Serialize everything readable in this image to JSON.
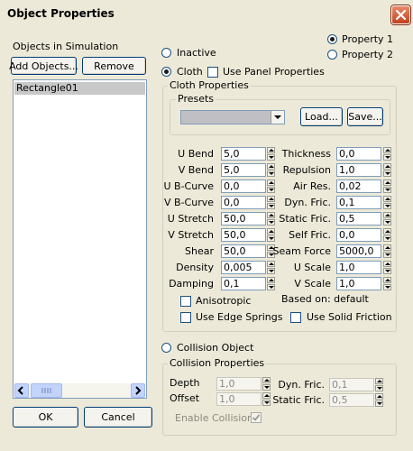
{
  "window": {
    "title": "Object Properties"
  },
  "objects_panel": {
    "heading": "Objects in Simulation",
    "add_button": "Add Objects...",
    "remove_button": "Remove",
    "items": [
      "Rectangle01"
    ]
  },
  "modes": {
    "inactive": "Inactive",
    "cloth": "Cloth",
    "use_panel_properties": "Use Panel Properties",
    "property1": "Property 1",
    "property2": "Property 2",
    "selected_mode": "Cloth",
    "selected_property": "Property 1"
  },
  "cloth_properties": {
    "title": "Cloth Properties",
    "presets": {
      "title": "Presets",
      "selected": "",
      "load_button": "Load...",
      "save_button": "Save..."
    },
    "left_params": [
      {
        "label": "U Bend",
        "value": "5,0"
      },
      {
        "label": "V Bend",
        "value": "5,0"
      },
      {
        "label": "U B-Curve",
        "value": "0,0"
      },
      {
        "label": "V B-Curve",
        "value": "0,0"
      },
      {
        "label": "U Stretch",
        "value": "50,0"
      },
      {
        "label": "V Stretch",
        "value": "50,0"
      },
      {
        "label": "Shear",
        "value": "50,0"
      },
      {
        "label": "Density",
        "value": "0,005"
      },
      {
        "label": "Damping",
        "value": "0,1"
      }
    ],
    "right_params": [
      {
        "label": "Thickness",
        "value": "0,0"
      },
      {
        "label": "Repulsion",
        "value": "1,0"
      },
      {
        "label": "Air Res.",
        "value": "0,02"
      },
      {
        "label": "Dyn. Fric.",
        "value": "0,1"
      },
      {
        "label": "Static Fric.",
        "value": "0,5"
      },
      {
        "label": "Self Fric.",
        "value": "0,0"
      },
      {
        "label": "Seam Force",
        "value": "5000,0"
      },
      {
        "label": "U Scale",
        "value": "1,0"
      },
      {
        "label": "V Scale",
        "value": "1,0"
      }
    ],
    "anisotropic": "Anisotropic",
    "based_on": "Based on: default",
    "use_edge_springs": "Use Edge Springs",
    "use_solid_friction": "Use Solid Friction"
  },
  "collision": {
    "radio_label": "Collision Object",
    "title": "Collision Properties",
    "depth_label": "Depth",
    "depth_value": "1,0",
    "offset_label": "Offset",
    "offset_value": "1,0",
    "dyn_fric_label": "Dyn. Fric.",
    "dyn_fric_value": "0,1",
    "static_fric_label": "Static Fric.",
    "static_fric_value": "0,5",
    "enable_collisions": "Enable Collisions",
    "enable_collisions_checked": true
  },
  "footer": {
    "ok": "OK",
    "cancel": "Cancel"
  },
  "colors": {
    "titlebar_close": "#c1401c",
    "dialog_bg": "#ece9d8",
    "border_accent": "#7f9db9"
  }
}
